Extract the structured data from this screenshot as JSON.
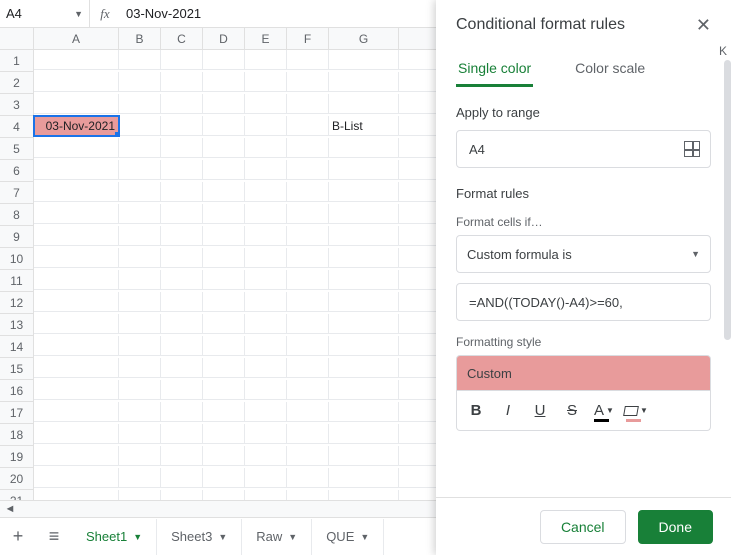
{
  "formula_bar": {
    "cell_ref": "A4",
    "fx_label": "fx",
    "value": "03-Nov-2021"
  },
  "columns": [
    "A",
    "B",
    "C",
    "D",
    "E",
    "F",
    "G"
  ],
  "extra_col": "K",
  "row_count": 21,
  "cells": {
    "A4": "03-Nov-2021",
    "G4": "B-List"
  },
  "sheet_bar": {
    "tabs": [
      {
        "label": "Sheet1",
        "active": true
      },
      {
        "label": "Sheet3",
        "active": false
      },
      {
        "label": "Raw",
        "active": false
      },
      {
        "label": "QUE",
        "active": false
      }
    ]
  },
  "sidebar": {
    "title": "Conditional format rules",
    "tabs": {
      "single_color": "Single color",
      "color_scale": "Color scale"
    },
    "apply_label": "Apply to range",
    "apply_value": "A4",
    "rules_label": "Format rules",
    "cells_if_label": "Format cells if…",
    "rule_type": "Custom formula is",
    "formula": "=AND((TODAY()-A4)>=60,",
    "style_label": "Formatting style",
    "style_name": "Custom",
    "cancel": "Cancel",
    "done": "Done"
  }
}
